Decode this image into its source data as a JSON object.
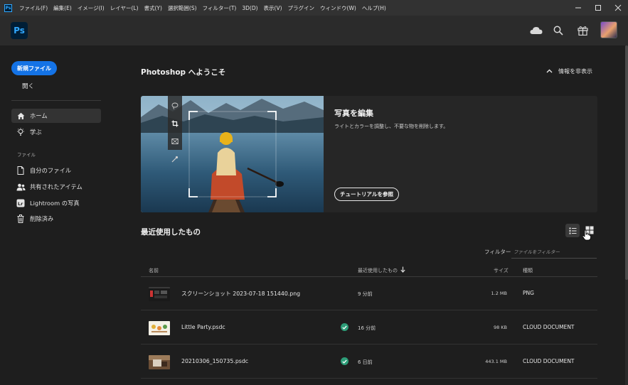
{
  "menubar": {
    "ps_label": "Ps",
    "items": [
      {
        "label": "ファイル(F)"
      },
      {
        "label": "編集(E)"
      },
      {
        "label": "イメージ(I)"
      },
      {
        "label": "レイヤー(L)"
      },
      {
        "label": "書式(Y)"
      },
      {
        "label": "選択範囲(S)"
      },
      {
        "label": "フィルター(T)"
      },
      {
        "label": "3D(D)"
      },
      {
        "label": "表示(V)"
      },
      {
        "label": "プラグイン"
      },
      {
        "label": "ウィンドウ(W)"
      },
      {
        "label": "ヘルプ(H)"
      }
    ],
    "window_controls": [
      "minimize-icon",
      "maximize-icon",
      "close-icon"
    ]
  },
  "appbar": {
    "logo": "Ps",
    "icons": [
      "cloud-icon",
      "search-icon",
      "gift-icon"
    ]
  },
  "leftnav": {
    "new_file": "新規ファイル",
    "open": "開く",
    "items": [
      {
        "label": "ホーム",
        "icon": "home-icon",
        "active": true
      },
      {
        "label": "学ぶ",
        "icon": "lightbulb-icon",
        "active": false
      }
    ],
    "files_section": "ファイル",
    "file_items": [
      {
        "label": "自分のファイル",
        "icon": "document-icon"
      },
      {
        "label": "共有されたアイテム",
        "icon": "shared-users-icon"
      },
      {
        "label": "Lightroom の写真",
        "icon": "lightroom-icon"
      },
      {
        "label": "削除済み",
        "icon": "trash-icon"
      }
    ],
    "lightroom_badge": "Lr"
  },
  "main": {
    "welcome_title": "Photoshop へようこそ",
    "hide_info": "情報を非表示",
    "hero": {
      "title": "写真を編集",
      "description": "ライトとカラーを調整し、不要な物を削除します。",
      "tutorial_button": "チュートリアルを参照",
      "tool_icons": [
        "lasso-icon",
        "crop-icon",
        "frame-icon",
        "eyedropper-icon"
      ]
    },
    "recent": {
      "title": "最近使用したもの",
      "filter_label": "フィルター",
      "filter_placeholder": "ファイルをフィルター",
      "columns": {
        "name": "名前",
        "modified": "最近使用したもの",
        "size": "サイズ",
        "kind": "種類"
      },
      "rows": [
        {
          "name": "スクリーンショット 2023-07-18 151440.png",
          "modified": "9 分前",
          "size": "1.2 MB",
          "kind": "PNG",
          "cloud": false
        },
        {
          "name": "Little Party.psdc",
          "modified": "16 分前",
          "size": "98 KB",
          "kind": "CLOUD DOCUMENT",
          "cloud": true
        },
        {
          "name": "20210306_150735.psdc",
          "modified": "6 日前",
          "size": "443.1 MB",
          "kind": "CLOUD DOCUMENT",
          "cloud": true
        }
      ]
    }
  },
  "colors": {
    "accent": "#1473e6",
    "ps_blue": "#31a8ff",
    "ps_dark": "#001e36",
    "synced_green": "#2d9d78",
    "background": "#1e1e1e"
  }
}
